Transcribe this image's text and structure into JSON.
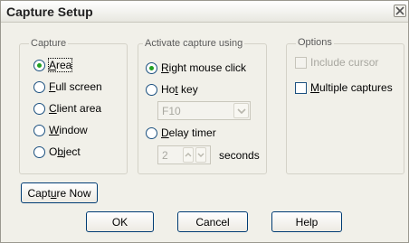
{
  "window": {
    "title": "Capture Setup",
    "close_icon": "close-icon"
  },
  "capture_group": {
    "title": "Capture",
    "selected": "area",
    "options": [
      {
        "id": "area",
        "label": "Area",
        "mnemonic_index": 0
      },
      {
        "id": "full_screen",
        "label": "Full screen",
        "mnemonic_index": 0
      },
      {
        "id": "client_area",
        "label": "Client area",
        "mnemonic_index": 0
      },
      {
        "id": "window",
        "label": "Window",
        "mnemonic_index": 0
      },
      {
        "id": "object",
        "label": "Object",
        "mnemonic_index": 1
      }
    ]
  },
  "activate_group": {
    "title": "Activate capture using",
    "selected": "right_mouse_click",
    "options": [
      {
        "id": "right_mouse_click",
        "label": "Right mouse click",
        "mnemonic_index": 0
      },
      {
        "id": "hot_key",
        "label": "Hot key",
        "mnemonic_index": 2
      },
      {
        "id": "delay_timer",
        "label": "Delay timer",
        "mnemonic_index": 0
      }
    ],
    "hotkey_value": "F10",
    "delay_value": "2",
    "seconds_label": "seconds"
  },
  "options_group": {
    "title": "Options",
    "include_cursor": {
      "label": "Include cursor",
      "checked": false,
      "disabled": true
    },
    "multiple_captures": {
      "label": "Multiple captures",
      "checked": false,
      "disabled": false
    }
  },
  "buttons": {
    "capture_now": "Capture Now",
    "ok": "OK",
    "cancel": "Cancel",
    "help": "Help"
  },
  "colors": {
    "dialog_bg": "#f1f0e9",
    "radio_dot": "#21a121",
    "control_border": "#1c5180",
    "button_border": "#003c74",
    "disabled_text": "#a8a7a0"
  }
}
